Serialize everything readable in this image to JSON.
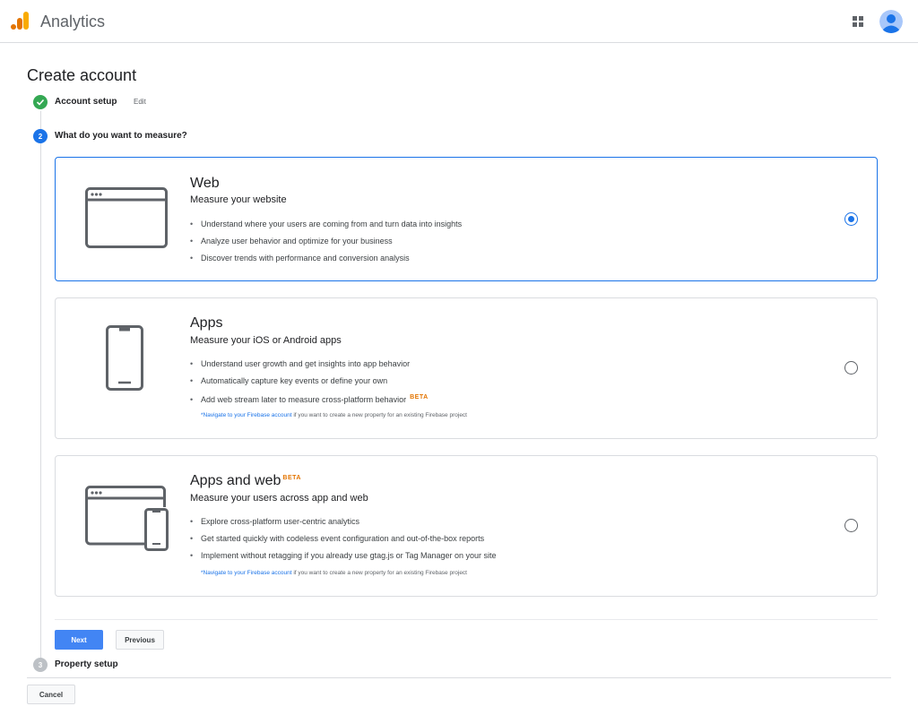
{
  "header": {
    "app_title": "Analytics"
  },
  "page": {
    "title": "Create account"
  },
  "steps": [
    {
      "number": "1",
      "label": "Account setup",
      "edit_label": "Edit",
      "status": "complete"
    },
    {
      "number": "2",
      "label": "What do you want to measure?",
      "status": "active"
    },
    {
      "number": "3",
      "label": "Property setup",
      "status": "pending"
    }
  ],
  "options": [
    {
      "title": "Web",
      "subtitle": "Measure your website",
      "bullets": [
        "Understand where your users are coming from and turn data into insights",
        "Analyze user behavior and optimize for your business",
        "Discover trends with performance and conversion analysis"
      ],
      "selected": true
    },
    {
      "title": "Apps",
      "subtitle": "Measure your iOS or Android apps",
      "bullets": [
        "Understand user growth and get insights into app behavior",
        "Automatically capture key events or define your own",
        "Add web stream later to measure cross-platform behavior"
      ],
      "badge": "BETA",
      "footnote_link": "*Navigate to your Firebase account",
      "footnote_text": " if you want to create a new property for an existing Firebase project",
      "selected": false
    },
    {
      "title": "Apps and web",
      "badge": "BETA",
      "subtitle": "Measure your users across app and web",
      "bullets": [
        "Explore cross-platform user-centric analytics",
        "Get started quickly with codeless event configuration and out-of-the-box reports",
        "Implement without retagging if you already use gtag.js or Tag Manager on your site"
      ],
      "footnote_link": "*Navigate to your Firebase account",
      "footnote_text": " if you want to create a new property for an existing Firebase project",
      "selected": false
    }
  ],
  "buttons": {
    "next": "Next",
    "previous": "Previous",
    "cancel": "Cancel"
  },
  "colors": {
    "accent": "#1a73e8",
    "step_complete": "#34a853",
    "beta": "#e37400",
    "next_button": "#4285f4"
  },
  "icons": {
    "logo": "analytics-logo-icon",
    "apps": "apps-grid-icon",
    "avatar": "account-avatar-icon",
    "check": "check-icon",
    "web": "browser-window-icon",
    "phone": "phone-icon",
    "combo": "browser-and-phone-icon"
  }
}
